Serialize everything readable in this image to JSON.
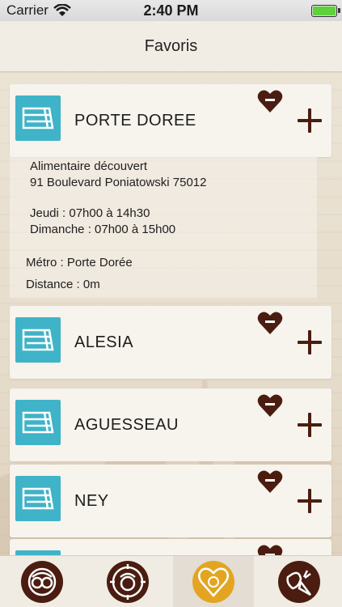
{
  "status_bar": {
    "carrier": "Carrier",
    "time": "2:40 PM",
    "wifi_icon": "wifi-icon",
    "battery_icon": "battery-icon"
  },
  "nav": {
    "title": "Favoris"
  },
  "markets": [
    {
      "name": "PORTE DOREE",
      "icon": "market-stall-icon"
    },
    {
      "name": "ALESIA",
      "icon": "market-stall-icon"
    },
    {
      "name": "AGUESSEAU",
      "icon": "market-stall-icon"
    },
    {
      "name": "NEY",
      "icon": "market-stall-icon"
    },
    {
      "name": "",
      "icon": "market-stall-icon"
    }
  ],
  "details": {
    "type": "Alimentaire découvert",
    "address": "91 Boulevard Poniatowski 75012",
    "schedule_1": "Jeudi : 07h00 à 14h30",
    "schedule_2": "Dimanche : 07h00 à 15h00",
    "metro": "Métro : Porte Dorée",
    "distance": "Distance : 0m"
  },
  "tabs": [
    {
      "name": "markets-map-tab",
      "icon": "chef-faces-icon"
    },
    {
      "name": "nearby-tab",
      "icon": "chef-target-icon"
    },
    {
      "name": "favorites-tab",
      "icon": "chef-heart-icon",
      "active": true
    },
    {
      "name": "produce-tab",
      "icon": "strawberry-carrot-icon"
    }
  ],
  "colors": {
    "accent_brown": "#4a1d10",
    "icon_teal": "#3fb3c7",
    "active_tab": "#e3a521"
  }
}
